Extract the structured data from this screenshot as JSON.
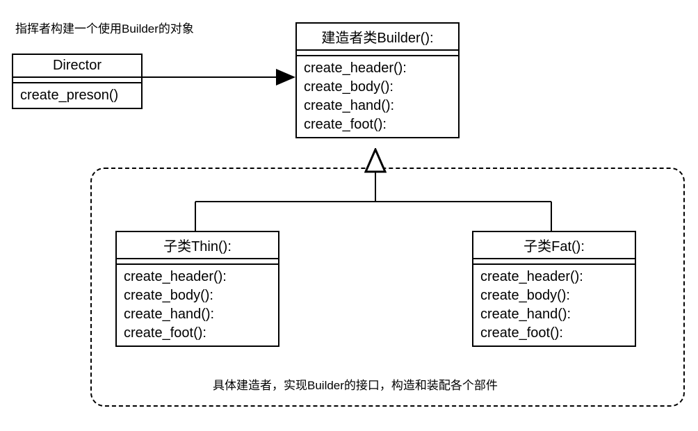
{
  "annotations": {
    "top_left": "指挥者构建一个使用Builder的对象",
    "bottom_caption": "具体建造者，实现Builder的接口，构造和装配各个部件"
  },
  "classes": {
    "director": {
      "title": "Director",
      "methods": [
        "create_preson()"
      ]
    },
    "builder": {
      "title": "建造者类Builder():",
      "methods": [
        "create_header():",
        "create_body():",
        "create_hand():",
        "create_foot():"
      ]
    },
    "thin": {
      "title": "子类Thin():",
      "methods": [
        "create_header():",
        "create_body():",
        "create_hand():",
        "create_foot():"
      ]
    },
    "fat": {
      "title": "子类Fat():",
      "methods": [
        "create_header():",
        "create_body():",
        "create_hand():",
        "create_foot():"
      ]
    }
  }
}
